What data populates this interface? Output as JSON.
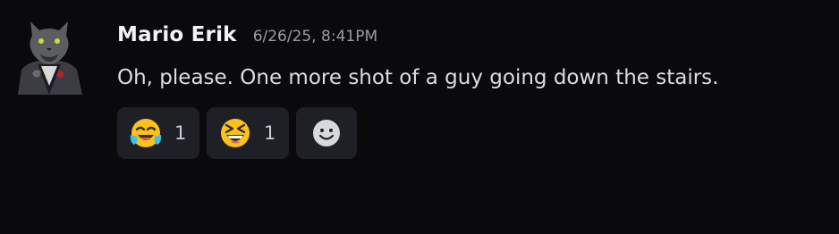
{
  "message": {
    "author": "Mario Erik",
    "timestamp": "6/26/25, 8:41PM",
    "text": "Oh, please. One more shot of a guy going down the stairs.",
    "avatar_icon": "werewolf-avatar"
  },
  "reactions": [
    {
      "emoji": "tears-of-joy",
      "count": "1"
    },
    {
      "emoji": "laughing-squinting",
      "count": "1"
    }
  ],
  "add_reaction_icon": "smiley-add-icon",
  "colors": {
    "background": "#0a0a0c",
    "reaction_bg": "#1f2026",
    "username": "#f2f3f5",
    "timestamp": "#9b9ca3",
    "text": "#dbdee1"
  }
}
